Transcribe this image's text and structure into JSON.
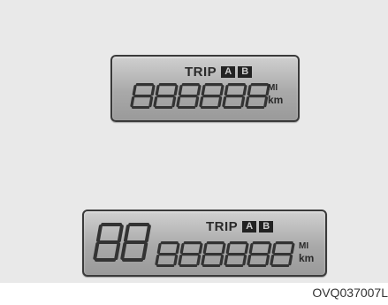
{
  "top_display": {
    "trip_label": "TRIP",
    "trip_a": "A",
    "trip_b": "B",
    "digits": "888888",
    "unit_mi": "MI",
    "unit_km": "km"
  },
  "bottom_display": {
    "big_digits": "88",
    "trip_label": "TRIP",
    "trip_a": "A",
    "trip_b": "B",
    "digits": "888888",
    "unit_mi": "MI",
    "unit_km": "km"
  },
  "figure_code": "OVQ037007L",
  "colors": {
    "segment_on": "#333333",
    "lcd_light": "#d0d0d0",
    "lcd_dark": "#9a9a9a",
    "background": "#e9e9e9"
  }
}
